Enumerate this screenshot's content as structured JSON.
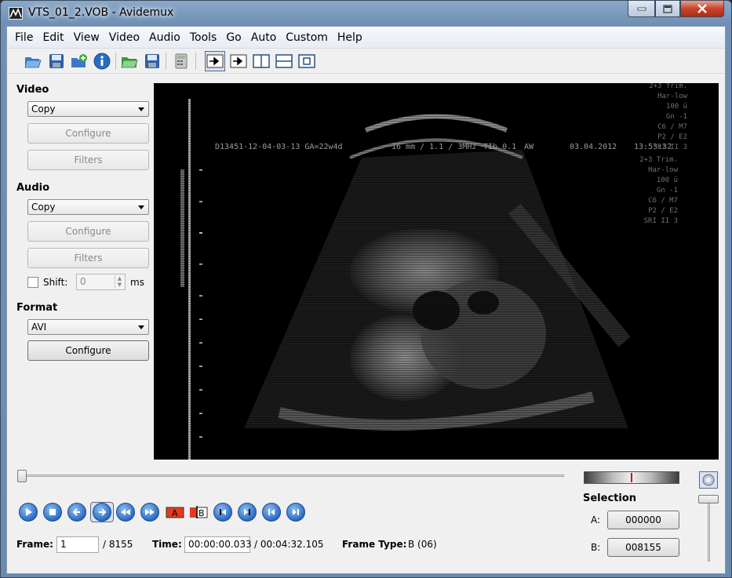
{
  "window": {
    "title": "VTS_01_2.VOB - Avidemux"
  },
  "menu": [
    "File",
    "Edit",
    "View",
    "Video",
    "Audio",
    "Tools",
    "Go",
    "Auto",
    "Custom",
    "Help"
  ],
  "video": {
    "label": "Video",
    "codec": "Copy",
    "configure_label": "Configure",
    "filters_label": "Filters"
  },
  "audio": {
    "label": "Audio",
    "codec": "Copy",
    "configure_label": "Configure",
    "filters_label": "Filters",
    "shift_label": "Shift:",
    "shift_value": "0",
    "shift_unit": "ms"
  },
  "format": {
    "label": "Format",
    "container": "AVI",
    "configure_label": "Configure"
  },
  "overlay": {
    "header": "D13451-12-04-03-13 GA=22w4d",
    "probe": "16 mm / 1.1 / 3MHz",
    "ti": "TIb 0.1",
    "aw": "AW",
    "date": "03.04.2012",
    "time": "13:53:32",
    "right_block_1": [
      "2+3 Trim.",
      "Har-low",
      "100 ü",
      "Gn -1",
      "C6 / M7",
      "P2 / E2",
      "SRI II 3"
    ],
    "right_block_2": [
      "2+3 Trim.",
      "Har-low",
      "100 ü",
      "Gn -1",
      "C6 / M7",
      "P2 / E2",
      "SRI II 3"
    ]
  },
  "status": {
    "frame_label": "Frame:",
    "frame_value": "1",
    "frame_total": "/ 8155",
    "time_label": "Time:",
    "time_value": "00:00:00.033",
    "time_total": "/ 00:04:32.105",
    "frame_type_label": "Frame Type:",
    "frame_type_value": "B (06)"
  },
  "selection": {
    "label": "Selection",
    "a_label": "A:",
    "a_value": "000000",
    "b_label": "B:",
    "b_value": "008155"
  },
  "icons": {
    "open": "folder-open-icon",
    "save": "save-icon",
    "append": "append-icon",
    "info": "info-icon",
    "open_project": "open-project-icon",
    "save_project": "save-project-icon",
    "calculator": "calculator-icon"
  },
  "colors": {
    "accent": "#2a6cc4",
    "close": "#c7432b",
    "marker": "#cc0000"
  }
}
